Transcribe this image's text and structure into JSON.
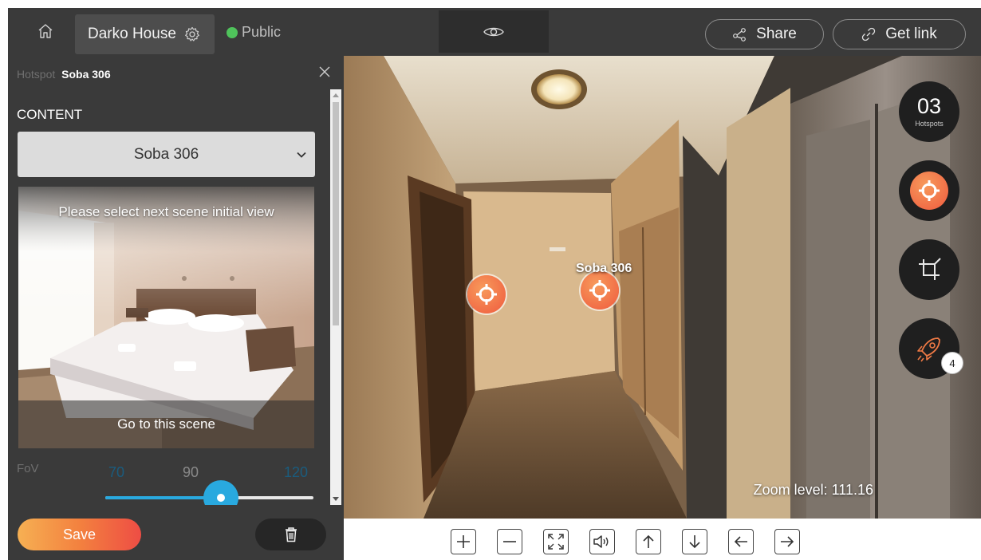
{
  "topbar": {
    "house_name": "Darko House",
    "visibility": "Public",
    "share_label": "Share",
    "get_link_label": "Get link",
    "icons": [
      "home-icon",
      "gear-icon",
      "eye-icon",
      "share-icon",
      "link-icon"
    ]
  },
  "panel": {
    "hotspot_kind": "Hotspot",
    "hotspot_name": "Soba 306",
    "content_label": "CONTENT",
    "content_selected": "Soba 306",
    "scene_prompt": "Please select next scene initial view",
    "go_to_scene": "Go to this scene",
    "fov": {
      "label": "FoV",
      "ticks": [
        "70",
        "90",
        "120"
      ],
      "value": 90,
      "min": 40,
      "max": 130
    },
    "save_label": "Save"
  },
  "viewer": {
    "hotspot_label": "Soba 306",
    "zoom_text": "Zoom level: 111.16",
    "hotspots_count": "03",
    "hotspots_label": "Hotspots",
    "badge_count": "4"
  },
  "toolbar": {
    "buttons": [
      "zoom-in",
      "zoom-out",
      "fullscreen",
      "sound",
      "up",
      "down",
      "left",
      "right"
    ]
  },
  "colors": {
    "topbar_bg": "#3a3a3a",
    "accent_blue": "#29a9df",
    "public_green": "#4fc35b",
    "hotspot_orange": "#ef5a3e",
    "save_gradient_start": "#f6b053",
    "save_gradient_end": "#ee4d44"
  }
}
